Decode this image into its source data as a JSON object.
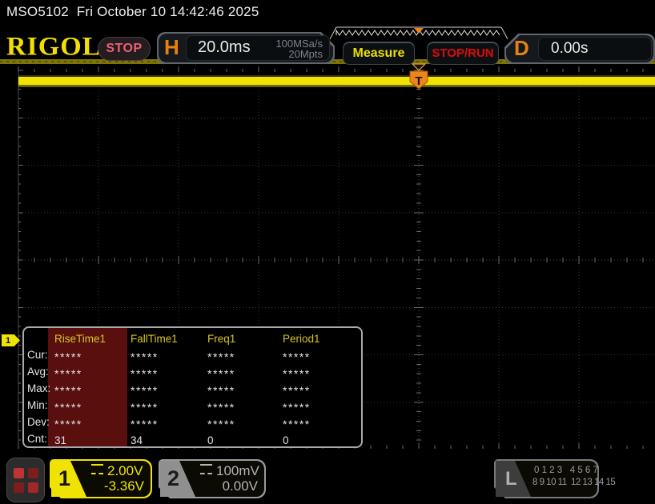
{
  "topbar": {
    "title": "MSO5102  Fri October 10 14:42:46 2025"
  },
  "header": {
    "brand": "RIGOL",
    "run_state": "STOP",
    "h_label": "H",
    "timebase": "20.0ms",
    "sample_rate": "100MSa/s",
    "mem_depth": "20Mpts",
    "measure_label": "Measure",
    "stop_run_label": "STOP/RUN",
    "d_label": "D",
    "delay": "0.00s"
  },
  "trigger": {
    "t_label": "T"
  },
  "measure_table": {
    "row_labels": [
      "Cur:",
      "Avg:",
      "Max:",
      "Min:",
      "Dev:",
      "Cnt:"
    ],
    "columns": [
      {
        "name": "RiseTime1",
        "highlighted": true,
        "values": [
          "*****",
          "*****",
          "*****",
          "*****",
          "*****",
          "31"
        ]
      },
      {
        "name": "FallTime1",
        "highlighted": false,
        "values": [
          "*****",
          "*****",
          "*****",
          "*****",
          "*****",
          "34"
        ]
      },
      {
        "name": "Freq1",
        "highlighted": false,
        "values": [
          "*****",
          "*****",
          "*****",
          "*****",
          "*****",
          "0"
        ]
      },
      {
        "name": "Period1",
        "highlighted": false,
        "values": [
          "*****",
          "*****",
          "*****",
          "*****",
          "*****",
          "0"
        ]
      }
    ]
  },
  "channels": {
    "ch1": {
      "number": "1",
      "scale": "2.00V",
      "offset": "-3.36V",
      "marker": "1"
    },
    "ch2": {
      "number": "2",
      "scale": "100mV",
      "offset": "0.00V"
    },
    "la": {
      "label": "L",
      "row1": "0 1 2 3   4 5 6 7",
      "row2": "8 9 10 11  12 13 14 15"
    }
  },
  "colors": {
    "accent_yellow": "#f0e202",
    "accent_orange": "#e8820e",
    "stop_badge_red": "#ee5f73",
    "stop_run_red": "#c41414",
    "measure_yellow": "#e8e000",
    "table_highlight": "#5a0f0f"
  }
}
